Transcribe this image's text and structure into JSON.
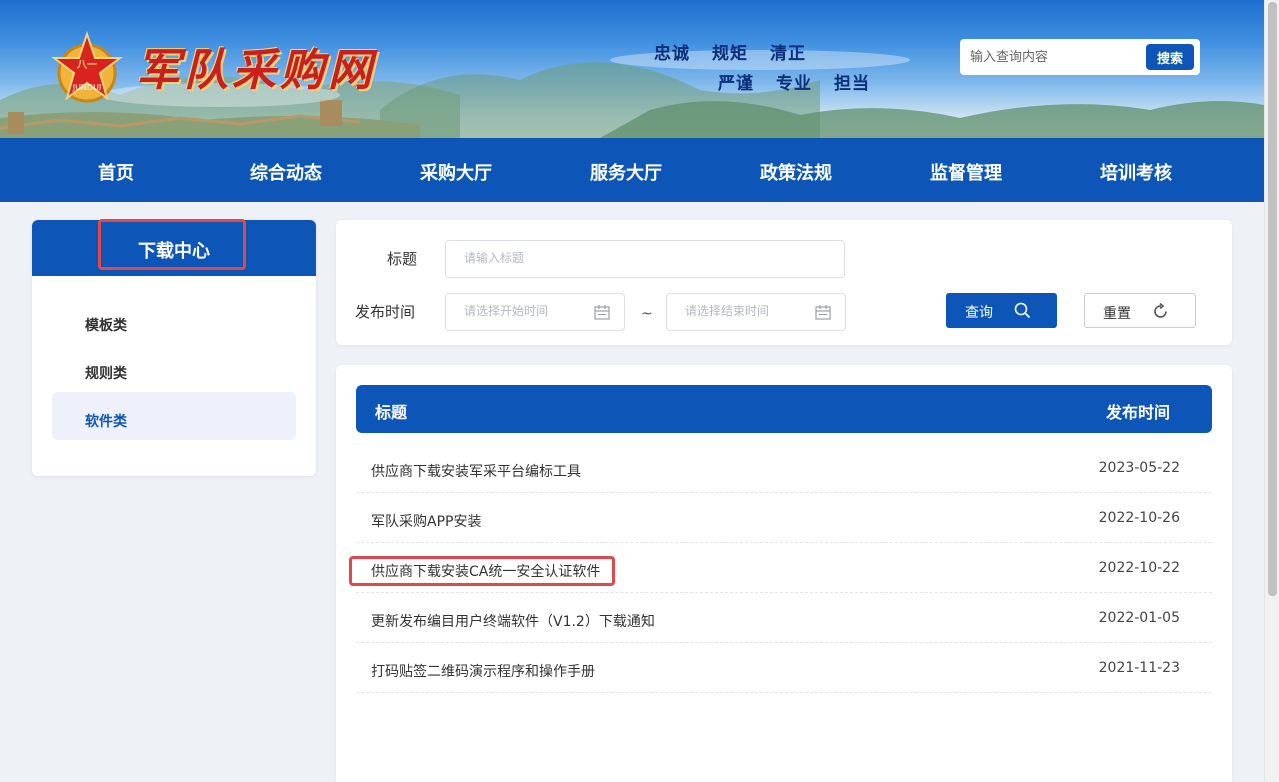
{
  "header": {
    "site_title": "军队采购网",
    "logo_text": "JUNDUI",
    "motto_line1": [
      "忠诚",
      "规矩",
      "清正"
    ],
    "motto_line2": [
      "严谨",
      "专业",
      "担当"
    ],
    "search_placeholder": "输入查询内容",
    "search_button": "搜索"
  },
  "nav": {
    "items": [
      "首页",
      "综合动态",
      "采购大厅",
      "服务大厅",
      "政策法规",
      "监督管理",
      "培训考核"
    ]
  },
  "sidebar": {
    "title": "下载中心",
    "items": [
      {
        "label": "模板类",
        "active": false
      },
      {
        "label": "规则类",
        "active": false
      },
      {
        "label": "软件类",
        "active": true
      }
    ]
  },
  "filter": {
    "title_label": "标题",
    "title_placeholder": "请输入标题",
    "date_label": "发布时间",
    "start_placeholder": "请选择开始时间",
    "end_placeholder": "请选择结束时间",
    "separator": "~",
    "query_button": "查询",
    "reset_button": "重置"
  },
  "list": {
    "col_title": "标题",
    "col_date": "发布时间",
    "rows": [
      {
        "title": "供应商下载安装军采平台编标工具",
        "date": "2023-05-22"
      },
      {
        "title": "军队采购APP安装",
        "date": "2022-10-26"
      },
      {
        "title": "供应商下载安装CA统一安全认证软件",
        "date": "2022-10-22"
      },
      {
        "title": "更新发布编目用户终端软件（V1.2）下载通知",
        "date": "2022-01-05"
      },
      {
        "title": "打码贴签二维码演示程序和操作手册",
        "date": "2021-11-23"
      }
    ]
  },
  "colors": {
    "primary": "#0d56b8",
    "highlight": "#e0484c"
  }
}
